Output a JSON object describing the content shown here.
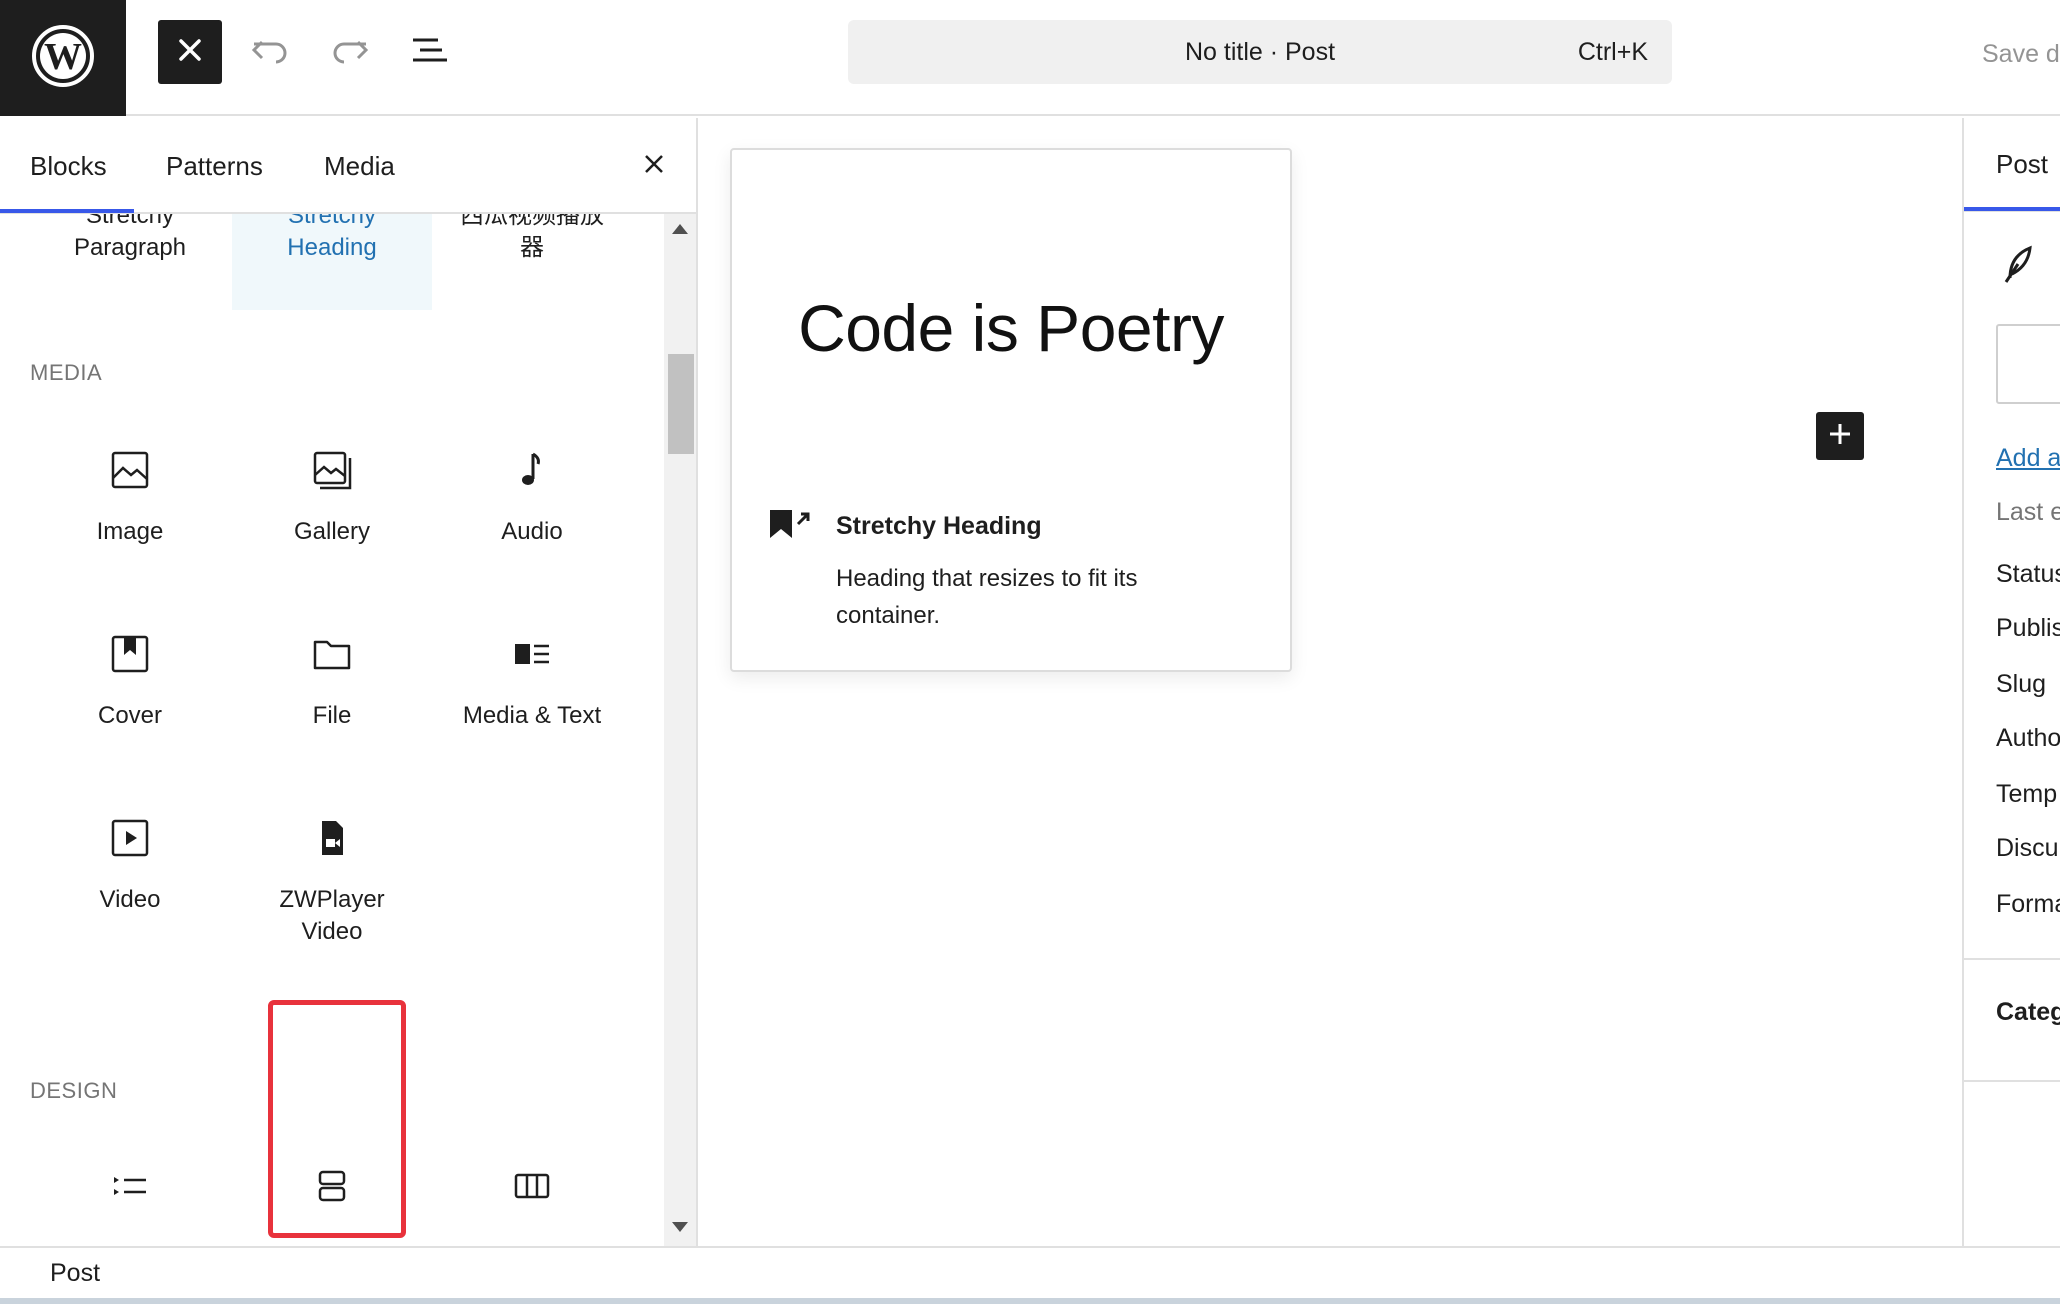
{
  "toolbar": {
    "command_title": "No title · Post",
    "command_shortcut": "Ctrl+K",
    "save_label": "Save draft",
    "icons": [
      "wordpress-logo-icon",
      "close-icon",
      "undo-icon",
      "redo-icon",
      "document-overview-icon"
    ]
  },
  "inserter": {
    "tabs": [
      {
        "label": "Blocks",
        "active": true
      },
      {
        "label": "Patterns",
        "active": false
      },
      {
        "label": "Media",
        "active": false
      }
    ],
    "top_row": [
      {
        "label": "Stretchy Paragraph",
        "visible_text": "Paragraph",
        "partial_text": "Stretchy"
      },
      {
        "label": "Stretchy Heading",
        "visible_text": "Heading",
        "partial_text": "Stretchy",
        "active": true
      },
      {
        "label": "西瓜视频播放器",
        "visible_text": "器",
        "partial_text": "西瓜视频播放"
      }
    ],
    "categories": [
      {
        "title": "MEDIA",
        "blocks": [
          {
            "label": "Image",
            "icon": "image-icon"
          },
          {
            "label": "Gallery",
            "icon": "gallery-icon"
          },
          {
            "label": "Audio",
            "icon": "audio-icon"
          },
          {
            "label": "Cover",
            "icon": "cover-icon"
          },
          {
            "label": "File",
            "icon": "file-icon"
          },
          {
            "label": "Media & Text",
            "icon": "media-text-icon"
          },
          {
            "label": "Video",
            "icon": "video-icon"
          },
          {
            "label": "ZWPlayer Video",
            "label_line1": "ZWPlayer",
            "label_line2": "Video",
            "icon": "zwplayer-video-icon",
            "highlighted": true
          }
        ]
      },
      {
        "title": "DESIGN",
        "blocks": [
          {
            "icon": "list-icon"
          },
          {
            "icon": "group-stack-icon"
          },
          {
            "icon": "columns-icon"
          }
        ]
      }
    ]
  },
  "preview": {
    "heading": "Code is Poetry",
    "block_title": "Stretchy Heading",
    "block_description": "Heading that resizes to fit its container."
  },
  "settings": {
    "tab": "Post",
    "add_link": "Add a",
    "last_edited": "Last e",
    "rows": [
      "Status",
      "Publis",
      "Slug",
      "Autho",
      "Temp",
      "Discu",
      "Forma"
    ],
    "section": "Categ"
  },
  "footer": {
    "breadcrumb": "Post"
  },
  "colors": {
    "dark": "#1e1e1e",
    "accent": "#3858e9",
    "link": "#2271b1",
    "highlight": "#e8323c"
  }
}
